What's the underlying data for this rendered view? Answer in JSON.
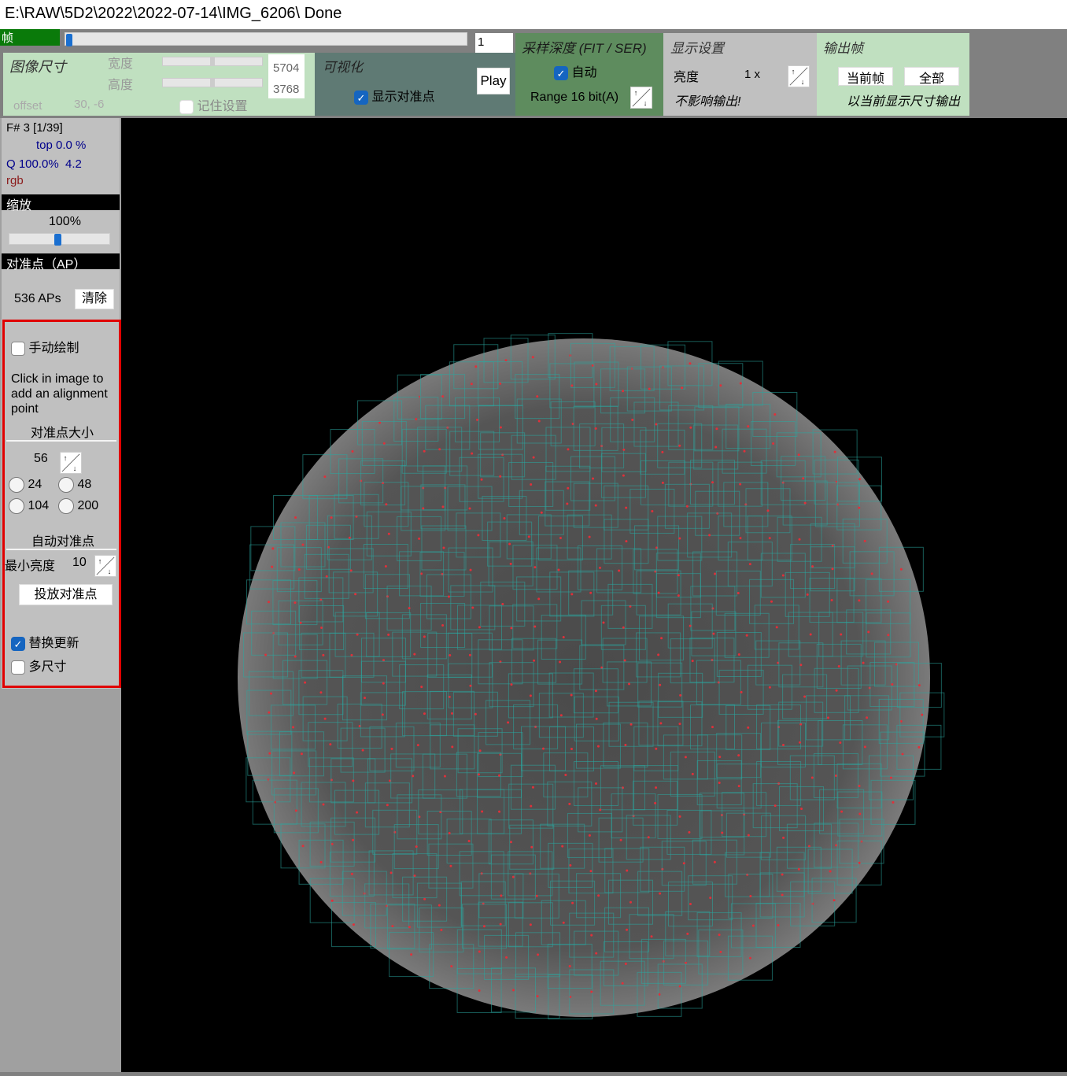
{
  "title": "E:\\RAW\\5D2\\2022\\2022-07-14\\IMG_6206\\   Done",
  "frame": {
    "label": "帧",
    "value": "1",
    "slider_fraction": 0.0,
    "play_label": "Play"
  },
  "image_size": {
    "title": "图像尺寸",
    "width_label": "宽度",
    "height_label": "高度",
    "width": "5704",
    "height": "3768",
    "offset_label": "offset",
    "offset": "30, -6",
    "remember_label": "记住设置",
    "remember_checked": false
  },
  "visualize": {
    "title": "可视化",
    "show_ap_label": "显示对准点",
    "show_ap_checked": true
  },
  "sampling": {
    "title": "采样深度 (FIT / SER)",
    "auto_label": "自动",
    "auto_checked": true,
    "range_label": "Range 16 bit(A)"
  },
  "display": {
    "title": "显示设置",
    "brightness_label": "亮度",
    "brightness_value": "1 x",
    "note": "不影响输出!"
  },
  "output": {
    "title": "输出帧",
    "current_label": "当前帧",
    "all_label": "全部",
    "note": "以当前显示尺寸输出"
  },
  "status": {
    "frame": "F# 3 [1/39]",
    "top": "top 0.0 %",
    "quality": "Q 100.0%  4.2",
    "mode": "rgb"
  },
  "zoom": {
    "header": "缩放",
    "value": "100%",
    "slider_fraction": 0.5
  },
  "ap": {
    "header": "对准点（AP）",
    "count": "536 APs",
    "clear_label": "清除",
    "manual_label": "手动绘制",
    "manual_checked": false,
    "hint": "Click in image to add an alignment point",
    "size_header": "对准点大小",
    "size_value": "56",
    "size_options": [
      "24",
      "48",
      "104",
      "200"
    ],
    "auto_header": "自动对准点",
    "min_brightness_label": "最小亮度",
    "min_brightness": "10",
    "place_label": "投放对准点",
    "replace_label": "替换更新",
    "replace_checked": true,
    "multi_label": "多尺寸",
    "multi_checked": false
  },
  "colors": {
    "frame_green": "#0a7a0a",
    "ap_box": "#2aa8a0",
    "ap_point": "#e0303a",
    "highlight": "#e00000"
  }
}
